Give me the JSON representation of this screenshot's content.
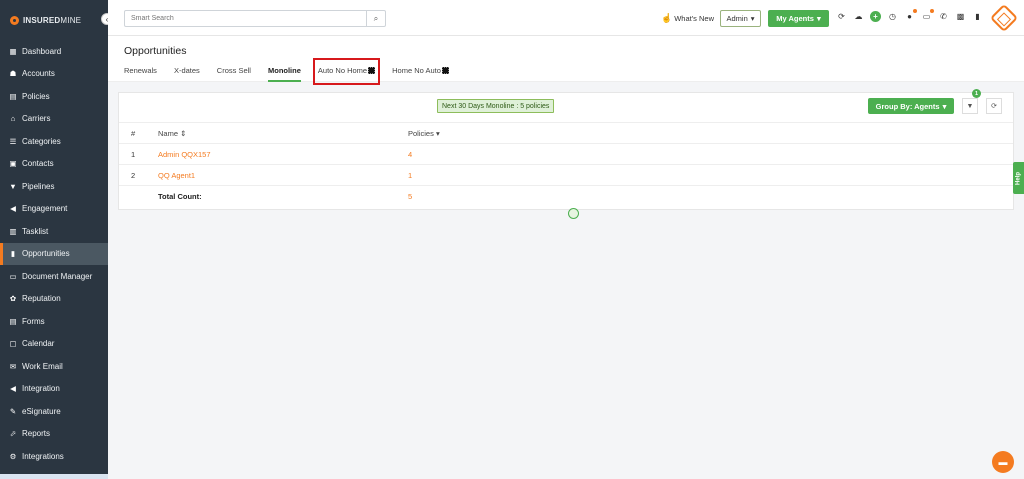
{
  "brand": {
    "name_bold": "INSURED",
    "name_thin": "MINE"
  },
  "sidebar": {
    "items": [
      {
        "label": "Dashboard",
        "icon": "▦"
      },
      {
        "label": "Accounts",
        "icon": "☗"
      },
      {
        "label": "Policies",
        "icon": "▤"
      },
      {
        "label": "Carriers",
        "icon": "⌂"
      },
      {
        "label": "Categories",
        "icon": "☰"
      },
      {
        "label": "Contacts",
        "icon": "▣"
      },
      {
        "label": "Pipelines",
        "icon": "▼"
      },
      {
        "label": "Engagement",
        "icon": "◀"
      },
      {
        "label": "Tasklist",
        "icon": "▥"
      },
      {
        "label": "Opportunities",
        "icon": "▮"
      },
      {
        "label": "Document Manager",
        "icon": "▭"
      },
      {
        "label": "Reputation",
        "icon": "✿"
      },
      {
        "label": "Forms",
        "icon": "▤"
      },
      {
        "label": "Calendar",
        "icon": "▢"
      },
      {
        "label": "Work Email",
        "icon": "✉"
      },
      {
        "label": "Integration",
        "icon": "◀"
      },
      {
        "label": "eSignature",
        "icon": "✎"
      },
      {
        "label": "Reports",
        "icon": "⬀"
      },
      {
        "label": "Integrations",
        "icon": "⚙"
      }
    ],
    "active_index": 9
  },
  "topbar": {
    "search_placeholder": "Smart Search",
    "whats_new": "What's New",
    "admin_select": "Admin",
    "my_agents": "My Agents"
  },
  "page": {
    "title": "Opportunities",
    "tabs": [
      "Renewals",
      "X-dates",
      "Cross Sell",
      "Monoline",
      "Auto No Home",
      "Home No Auto"
    ],
    "active_tab": "Monoline",
    "highlighted_tab": "Auto No Home"
  },
  "card": {
    "summary": "Next 30  Days Monoline : 5 policies",
    "group_by": "Group By: Agents",
    "filter_count": "1",
    "table": {
      "headers": [
        "#",
        "Name",
        "Policies"
      ],
      "rows": [
        {
          "num": "1",
          "name": "Admin QQX157",
          "policies": "4"
        },
        {
          "num": "2",
          "name": "QQ Agent1",
          "policies": "1"
        }
      ],
      "total_label": "Total Count:",
      "total_value": "5"
    }
  },
  "help_label": "Help",
  "colors": {
    "accent_green": "#4caf50",
    "brand_orange": "#f47b20",
    "sidebar_bg": "#2b3641"
  }
}
